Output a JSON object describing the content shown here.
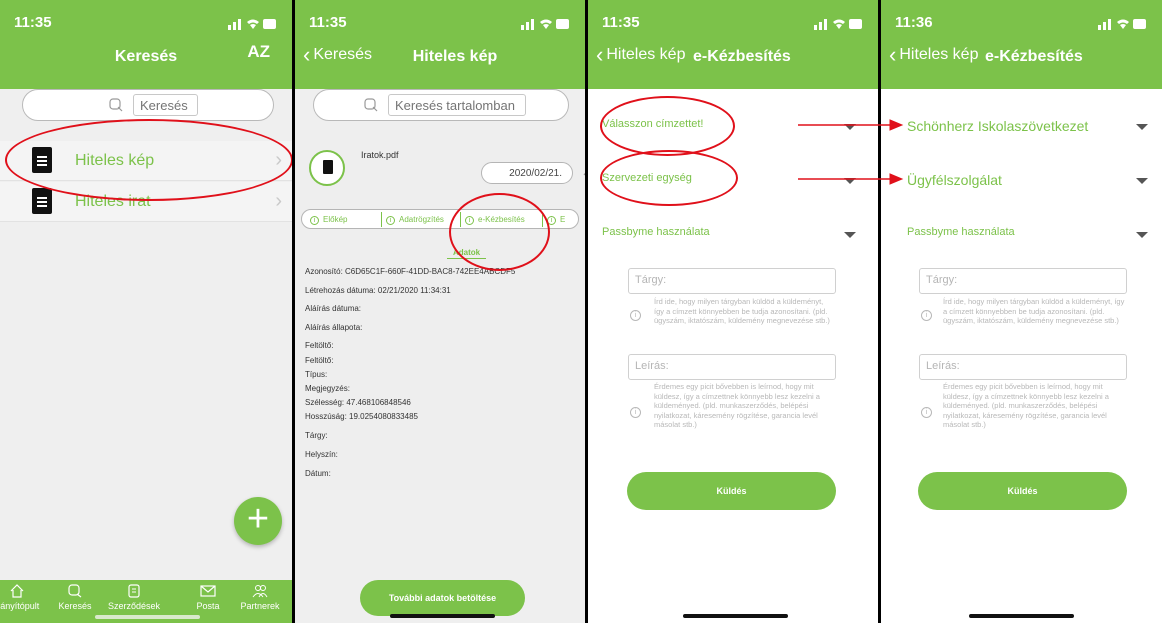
{
  "colors": {
    "accent": "#7cc24a",
    "annotation": "#e0101a"
  },
  "phone1": {
    "time": "11:35",
    "title": "Keresés",
    "sort_icon_text": "AZ",
    "search_placeholder": "Keresés",
    "items": [
      {
        "label": "Hiteles kép"
      },
      {
        "label": "Hiteles irat"
      }
    ],
    "tabs": [
      {
        "label": "Irányítópult",
        "icon": "home-icon"
      },
      {
        "label": "Keresés",
        "icon": "search-icon"
      },
      {
        "label": "Szerződések",
        "icon": "contract-icon"
      },
      {
        "label": "Posta",
        "icon": "mail-icon"
      },
      {
        "label": "Partnerek",
        "icon": "partners-icon"
      }
    ],
    "fab_label": "+"
  },
  "phone2": {
    "time": "11:35",
    "back_label": "Keresés",
    "title": "Hiteles kép",
    "search_placeholder": "Keresés tartalomban",
    "file_name": "Iratok.pdf",
    "file_date": "2020/02/21.",
    "subtabs": [
      "Előkép",
      "Adatrögzítés",
      "e-Kézbesítés",
      "E"
    ],
    "section_title": "Adatok",
    "fields": [
      "Azonosító:  C6D65C1F-660F-41DD-BAC8-742EE4ABCDF5",
      "Létrehozás dátuma:  02/21/2020 11:34:31",
      "Aláírás dátuma:",
      "Aláírás állapota:",
      "Feltöltő:",
      "Feltöltő:",
      "Típus:",
      "Megjegyzés:",
      "Szélesség:  47.468106848546",
      "Hosszúság:  19.0254080833485",
      "Tárgy:",
      "Helyszín:",
      "Dátum:"
    ],
    "load_more_label": "További adatok betöltése"
  },
  "phone3": {
    "time": "11:35",
    "back_label": "Hiteles kép",
    "title": "e-Kézbesítés",
    "recipient_label": "Válasszon címzettet!",
    "unit_label": "Szervezeti egység",
    "passbyme_label": "Passbyme használata",
    "subject_placeholder": "Tárgy:",
    "subject_hint": "Írd ide, hogy milyen tárgyban küldöd a küldeményt, így a címzett könnyebben be tudja azonosítani. (pld. ügyszám, iktatószám, küldemény megnevezése stb.)",
    "description_placeholder": "Leírás:",
    "description_hint": "Érdemes egy picit bővebben is leírnod, hogy mit küldesz, így a címzettnek könnyebb lesz kezelni a küldeményed. (pld. munkaszerződés, belépési nyilatkozat, káresemény rögzítése, garancia levél másolat stb.)",
    "send_label": "Küldés"
  },
  "phone4": {
    "time": "11:36",
    "back_label": "Hiteles kép",
    "title": "e-Kézbesítés",
    "recipient_value": "Schönherz Iskolaszövetkezet",
    "unit_value": "Ügyfélszolgálat",
    "passbyme_label": "Passbyme használata",
    "subject_placeholder": "Tárgy:",
    "subject_hint": "Írd ide, hogy milyen tárgyban küldöd a küldeményt, így a címzett könnyebben be tudja azonosítani. (pld. ügyszám, iktatószám, küldemény megnevezése stb.)",
    "description_placeholder": "Leírás:",
    "description_hint": "Érdemes egy picit bővebben is leírnod, hogy mit küldesz, így a címzettnek könnyebb lesz kezelni a küldeményed. (pld. munkaszerződés, belépési nyilatkozat, káresemény rögzítése, garancia levél másolat stb.)",
    "send_label": "Küldés"
  }
}
